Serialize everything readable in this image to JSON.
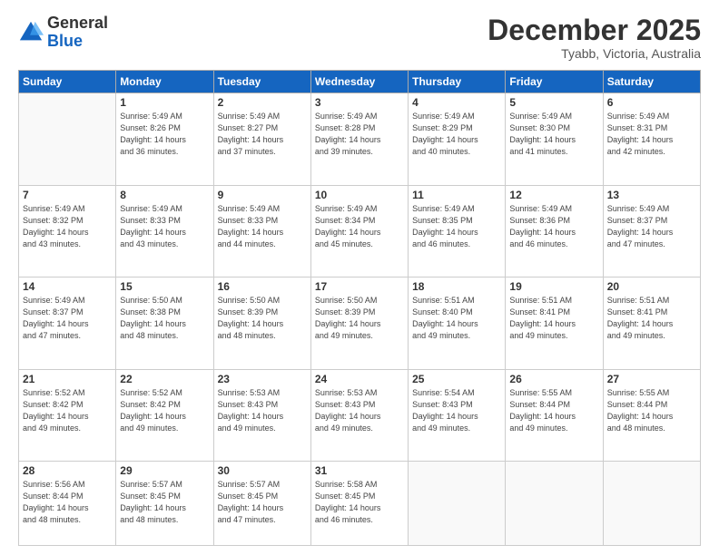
{
  "logo": {
    "general": "General",
    "blue": "Blue"
  },
  "header": {
    "month": "December 2025",
    "location": "Tyabb, Victoria, Australia"
  },
  "weekdays": [
    "Sunday",
    "Monday",
    "Tuesday",
    "Wednesday",
    "Thursday",
    "Friday",
    "Saturday"
  ],
  "weeks": [
    [
      {
        "day": "",
        "info": ""
      },
      {
        "day": "1",
        "info": "Sunrise: 5:49 AM\nSunset: 8:26 PM\nDaylight: 14 hours\nand 36 minutes."
      },
      {
        "day": "2",
        "info": "Sunrise: 5:49 AM\nSunset: 8:27 PM\nDaylight: 14 hours\nand 37 minutes."
      },
      {
        "day": "3",
        "info": "Sunrise: 5:49 AM\nSunset: 8:28 PM\nDaylight: 14 hours\nand 39 minutes."
      },
      {
        "day": "4",
        "info": "Sunrise: 5:49 AM\nSunset: 8:29 PM\nDaylight: 14 hours\nand 40 minutes."
      },
      {
        "day": "5",
        "info": "Sunrise: 5:49 AM\nSunset: 8:30 PM\nDaylight: 14 hours\nand 41 minutes."
      },
      {
        "day": "6",
        "info": "Sunrise: 5:49 AM\nSunset: 8:31 PM\nDaylight: 14 hours\nand 42 minutes."
      }
    ],
    [
      {
        "day": "7",
        "info": "Sunrise: 5:49 AM\nSunset: 8:32 PM\nDaylight: 14 hours\nand 43 minutes."
      },
      {
        "day": "8",
        "info": "Sunrise: 5:49 AM\nSunset: 8:33 PM\nDaylight: 14 hours\nand 43 minutes."
      },
      {
        "day": "9",
        "info": "Sunrise: 5:49 AM\nSunset: 8:33 PM\nDaylight: 14 hours\nand 44 minutes."
      },
      {
        "day": "10",
        "info": "Sunrise: 5:49 AM\nSunset: 8:34 PM\nDaylight: 14 hours\nand 45 minutes."
      },
      {
        "day": "11",
        "info": "Sunrise: 5:49 AM\nSunset: 8:35 PM\nDaylight: 14 hours\nand 46 minutes."
      },
      {
        "day": "12",
        "info": "Sunrise: 5:49 AM\nSunset: 8:36 PM\nDaylight: 14 hours\nand 46 minutes."
      },
      {
        "day": "13",
        "info": "Sunrise: 5:49 AM\nSunset: 8:37 PM\nDaylight: 14 hours\nand 47 minutes."
      }
    ],
    [
      {
        "day": "14",
        "info": "Sunrise: 5:49 AM\nSunset: 8:37 PM\nDaylight: 14 hours\nand 47 minutes."
      },
      {
        "day": "15",
        "info": "Sunrise: 5:50 AM\nSunset: 8:38 PM\nDaylight: 14 hours\nand 48 minutes."
      },
      {
        "day": "16",
        "info": "Sunrise: 5:50 AM\nSunset: 8:39 PM\nDaylight: 14 hours\nand 48 minutes."
      },
      {
        "day": "17",
        "info": "Sunrise: 5:50 AM\nSunset: 8:39 PM\nDaylight: 14 hours\nand 49 minutes."
      },
      {
        "day": "18",
        "info": "Sunrise: 5:51 AM\nSunset: 8:40 PM\nDaylight: 14 hours\nand 49 minutes."
      },
      {
        "day": "19",
        "info": "Sunrise: 5:51 AM\nSunset: 8:41 PM\nDaylight: 14 hours\nand 49 minutes."
      },
      {
        "day": "20",
        "info": "Sunrise: 5:51 AM\nSunset: 8:41 PM\nDaylight: 14 hours\nand 49 minutes."
      }
    ],
    [
      {
        "day": "21",
        "info": "Sunrise: 5:52 AM\nSunset: 8:42 PM\nDaylight: 14 hours\nand 49 minutes."
      },
      {
        "day": "22",
        "info": "Sunrise: 5:52 AM\nSunset: 8:42 PM\nDaylight: 14 hours\nand 49 minutes."
      },
      {
        "day": "23",
        "info": "Sunrise: 5:53 AM\nSunset: 8:43 PM\nDaylight: 14 hours\nand 49 minutes."
      },
      {
        "day": "24",
        "info": "Sunrise: 5:53 AM\nSunset: 8:43 PM\nDaylight: 14 hours\nand 49 minutes."
      },
      {
        "day": "25",
        "info": "Sunrise: 5:54 AM\nSunset: 8:43 PM\nDaylight: 14 hours\nand 49 minutes."
      },
      {
        "day": "26",
        "info": "Sunrise: 5:55 AM\nSunset: 8:44 PM\nDaylight: 14 hours\nand 49 minutes."
      },
      {
        "day": "27",
        "info": "Sunrise: 5:55 AM\nSunset: 8:44 PM\nDaylight: 14 hours\nand 48 minutes."
      }
    ],
    [
      {
        "day": "28",
        "info": "Sunrise: 5:56 AM\nSunset: 8:44 PM\nDaylight: 14 hours\nand 48 minutes."
      },
      {
        "day": "29",
        "info": "Sunrise: 5:57 AM\nSunset: 8:45 PM\nDaylight: 14 hours\nand 48 minutes."
      },
      {
        "day": "30",
        "info": "Sunrise: 5:57 AM\nSunset: 8:45 PM\nDaylight: 14 hours\nand 47 minutes."
      },
      {
        "day": "31",
        "info": "Sunrise: 5:58 AM\nSunset: 8:45 PM\nDaylight: 14 hours\nand 46 minutes."
      },
      {
        "day": "",
        "info": ""
      },
      {
        "day": "",
        "info": ""
      },
      {
        "day": "",
        "info": ""
      }
    ]
  ]
}
